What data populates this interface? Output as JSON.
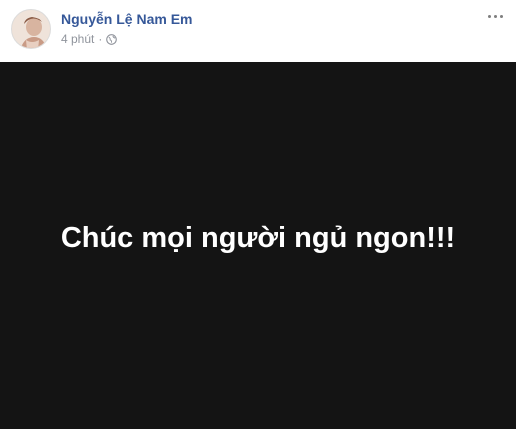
{
  "post": {
    "author_name": "Nguyễn Lệ Nam Em",
    "timestamp": "4 phút",
    "separator": "·",
    "privacy_icon": "globe-icon",
    "more_icon": "more-options-icon",
    "status_text": "Chúc mọi người ngủ ngon!!!",
    "status_background_color": "#141414",
    "status_text_color": "#ffffff",
    "author_name_color": "#365899"
  }
}
